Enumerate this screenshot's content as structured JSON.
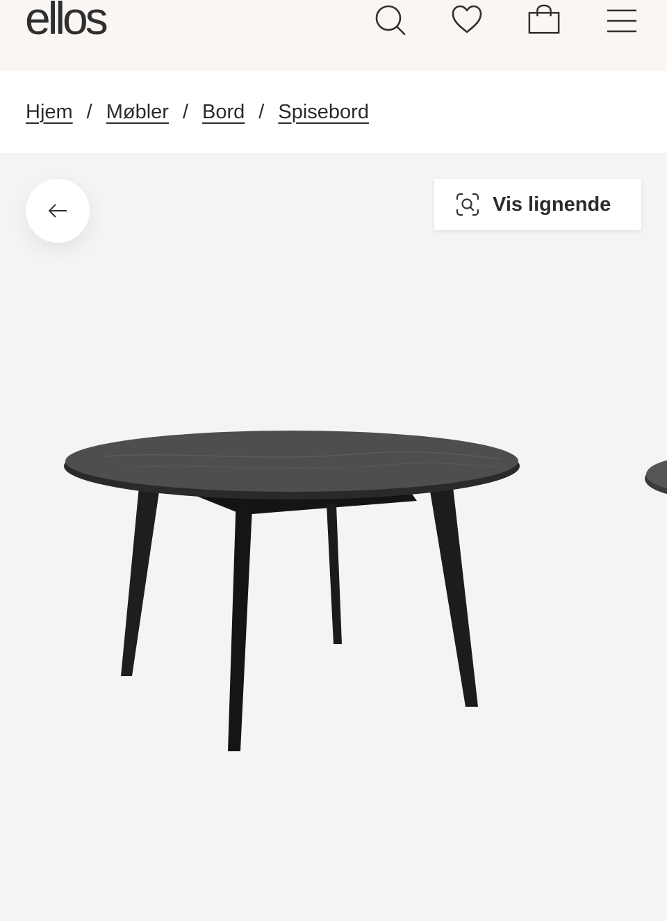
{
  "header": {
    "logo": "ellos",
    "icons": [
      "search-icon",
      "heart-icon",
      "bag-icon",
      "menu-icon"
    ]
  },
  "breadcrumb": {
    "items": [
      "Hjem",
      "Møbler",
      "Bord",
      "Spisebord"
    ],
    "separator": "/"
  },
  "gallery": {
    "similar_label": "Vis lignende",
    "back_icon": "arrow-left-icon",
    "similar_icon": "visual-search-icon"
  },
  "colors": {
    "header_bg": "#f9f6f4",
    "gallery_bg": "#f4f4f4",
    "text": "#2b2b2b",
    "table": "#1c1c1c"
  }
}
